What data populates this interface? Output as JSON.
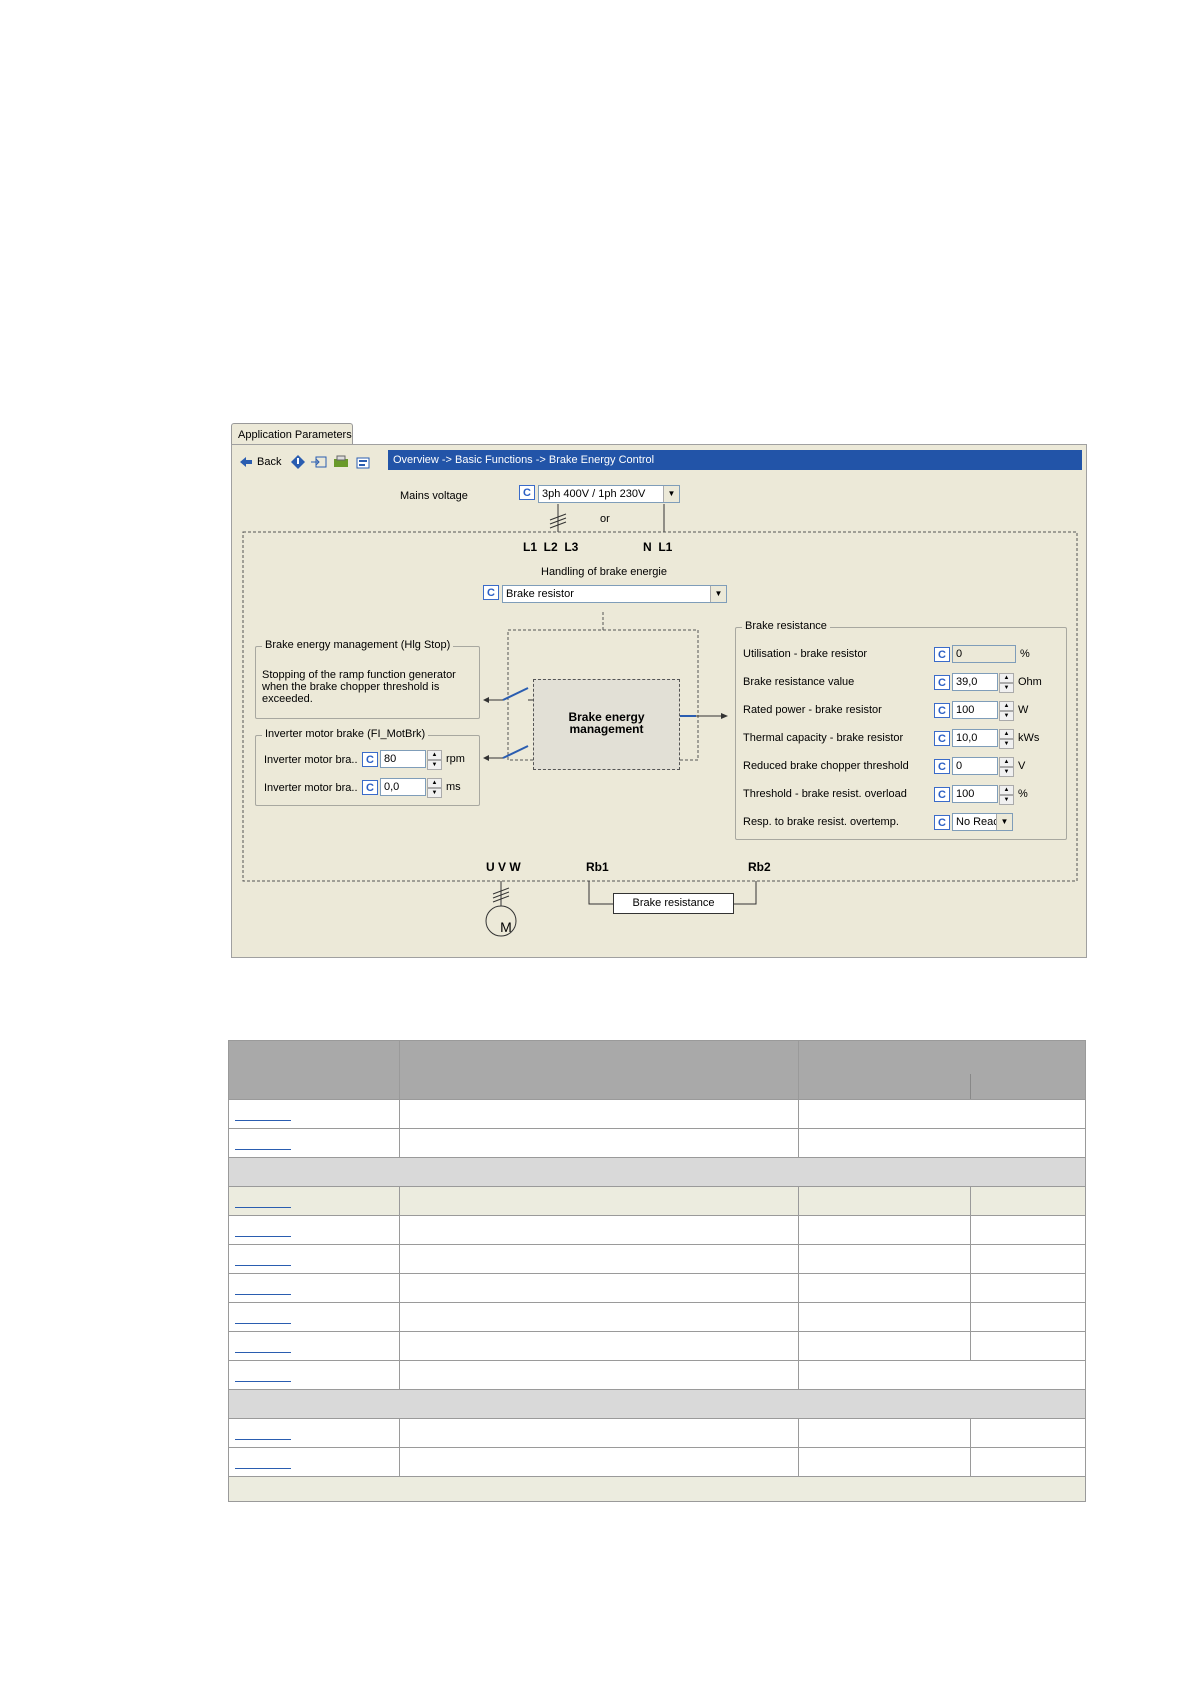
{
  "window": {
    "tab_label": "Application Parameters",
    "toolbar": {
      "back_label": "Back"
    },
    "breadcrumb": "Overview -> Basic Functions -> Brake Energy Control"
  },
  "mains": {
    "label": "Mains voltage",
    "value": "3ph 400V / 1ph 230V",
    "or_label": "or",
    "terminals_left": "L1  L2  L3",
    "terminals_right": "N  L1"
  },
  "handling": {
    "label": "Handling of brake energie",
    "value": "Brake resistor"
  },
  "hlg_stop": {
    "title": "Brake energy management (Hlg Stop)",
    "text": "Stopping of the ramp function generator when the brake chopper threshold is exceeded."
  },
  "motor_brake": {
    "title": "Inverter motor brake (FI_MotBrk)",
    "rows": [
      {
        "label": "Inverter motor bra..",
        "value": "80",
        "unit": "rpm"
      },
      {
        "label": "Inverter motor bra..",
        "value": "0,0",
        "unit": "ms"
      }
    ]
  },
  "center_block": {
    "line1": "Brake energy",
    "line2": "management"
  },
  "brake_resistance": {
    "title": "Brake resistance",
    "rows": [
      {
        "label": "Utilisation - brake resistor",
        "value": "0",
        "unit": "%"
      },
      {
        "label": "Brake resistance value",
        "value": "39,0",
        "unit": "Ohm"
      },
      {
        "label": "Rated power - brake resistor",
        "value": "100",
        "unit": "W"
      },
      {
        "label": "Thermal capacity - brake resistor",
        "value": "10,0",
        "unit": "kWs"
      },
      {
        "label": "Reduced brake chopper threshold",
        "value": "0",
        "unit": "V"
      },
      {
        "label": "Threshold - brake resist. overload",
        "value": "100",
        "unit": "%"
      },
      {
        "label": "Resp. to brake resist. overtemp.",
        "value": "No Reac",
        "unit": ""
      }
    ]
  },
  "bottom": {
    "uvw": "U V W",
    "rb1": "Rb1",
    "rb2": "Rb2",
    "resistance_box": "Brake resistance",
    "motor": "M"
  }
}
